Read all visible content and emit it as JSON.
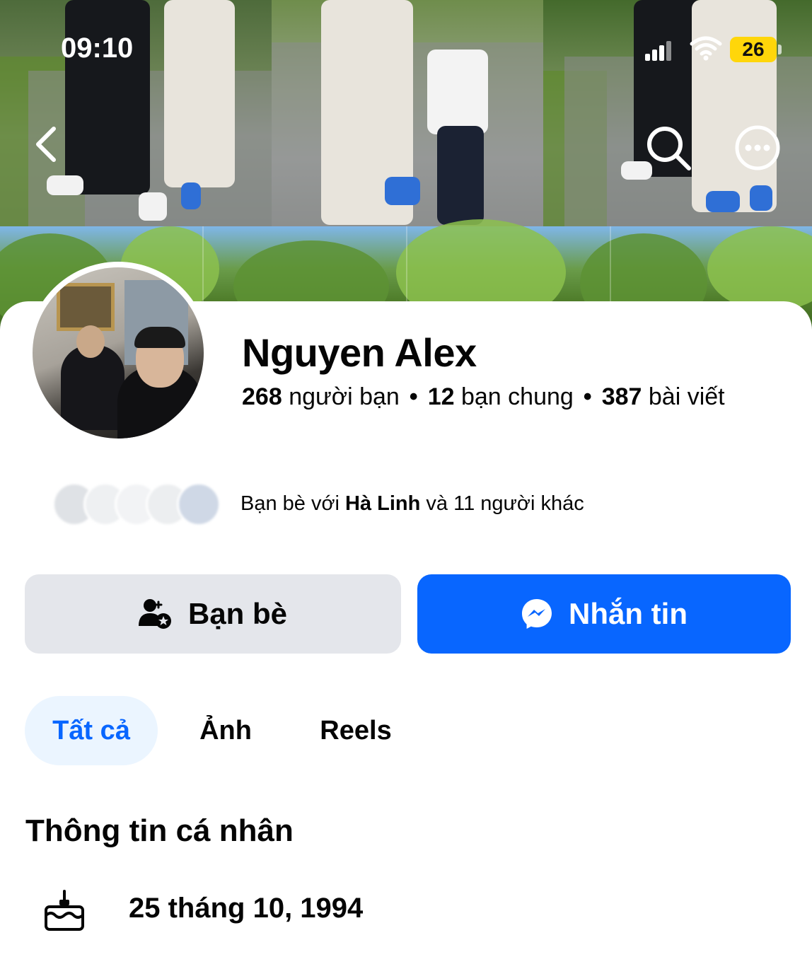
{
  "status_bar": {
    "time": "09:10",
    "battery": "26"
  },
  "profile": {
    "name": "Nguyen Alex",
    "friends_count": "268",
    "friends_label": "người bạn",
    "mutual_count": "12",
    "mutual_label": "bạn chung",
    "posts_count": "387",
    "posts_label": "bài viết"
  },
  "mutual_friends": {
    "prefix": "Bạn bè với",
    "highlight_name": "Hà Linh",
    "suffix": "và 11 người khác"
  },
  "actions": {
    "friends_label": "Bạn bè",
    "message_label": "Nhắn tin"
  },
  "tabs": [
    {
      "label": "Tất cả",
      "active": true
    },
    {
      "label": "Ảnh",
      "active": false
    },
    {
      "label": "Reels",
      "active": false
    }
  ],
  "personal_info": {
    "title": "Thông tin cá nhân",
    "birthday": "25 tháng 10, 1994"
  },
  "icons": {
    "back": "chevron-left-icon",
    "search": "search-icon",
    "more": "more-options-icon",
    "friends": "friend-check-icon",
    "message": "messenger-icon",
    "birthday": "birthday-cake-icon"
  },
  "colors": {
    "accent": "#0866ff",
    "secondary_button": "#e4e6eb",
    "active_tab_bg": "#ebf5ff",
    "battery": "#ffd60a"
  }
}
